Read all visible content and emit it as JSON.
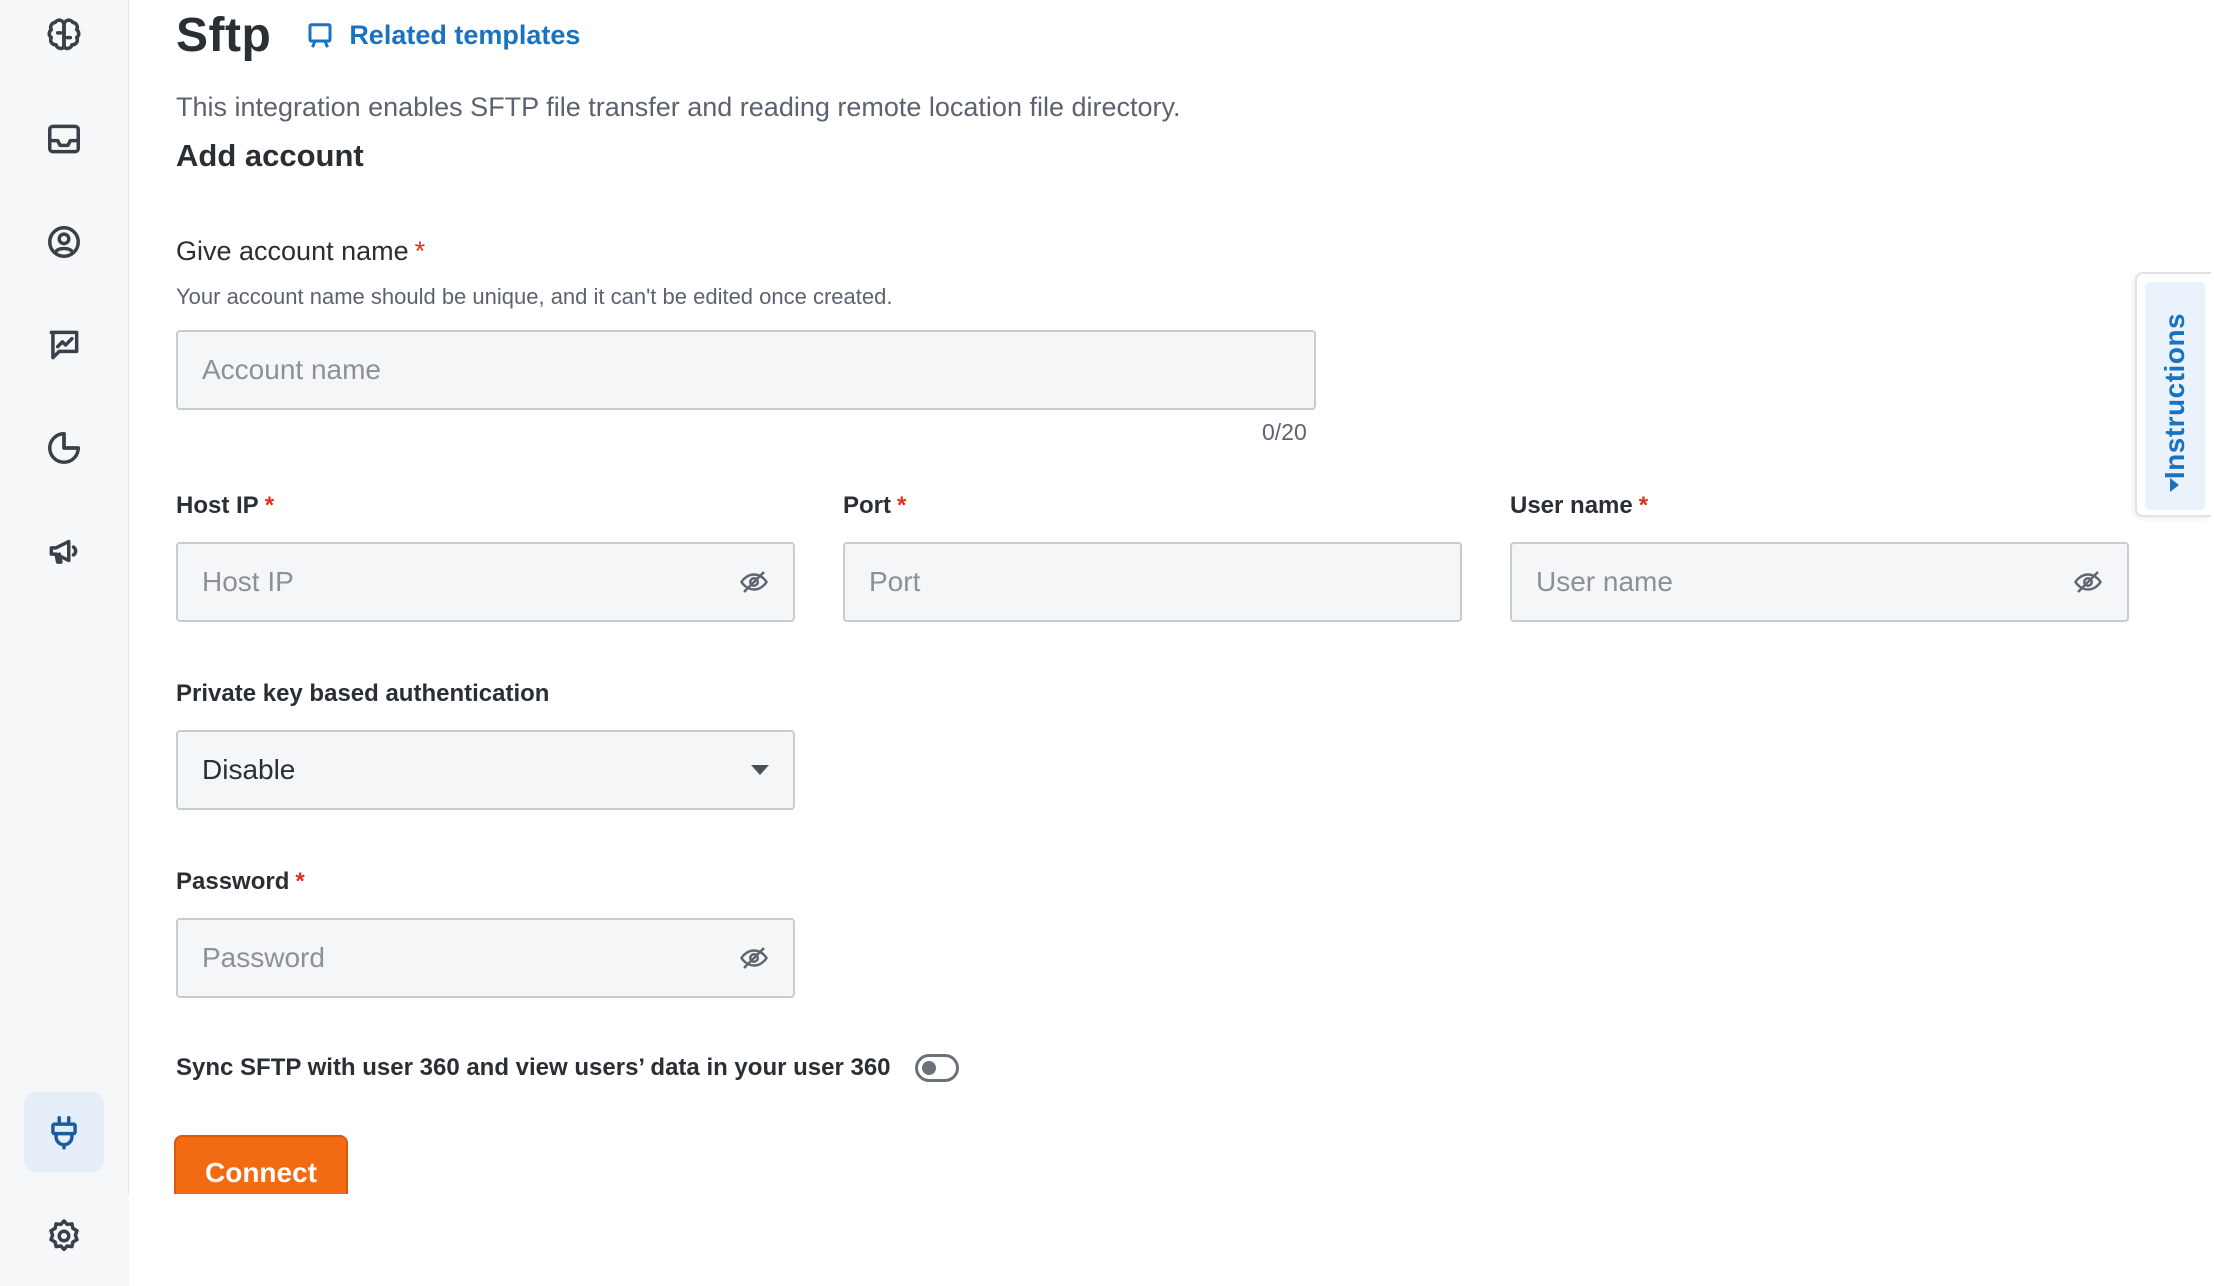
{
  "page": {
    "title": "Sftp",
    "related_templates": "Related templates",
    "description": "This integration enables SFTP file transfer and reading remote location file directory.",
    "section_title": "Add account"
  },
  "account_name": {
    "label": "Give account name",
    "required_mark": "*",
    "hint": "Your account name should be unique, and it can't be edited once created.",
    "placeholder": "Account name",
    "value": "",
    "counter": "0/20"
  },
  "host_ip": {
    "label": "Host IP",
    "required_mark": "*",
    "placeholder": "Host IP",
    "value": ""
  },
  "port": {
    "label": "Port",
    "required_mark": "*",
    "placeholder": "Port",
    "value": ""
  },
  "user_name": {
    "label": "User name",
    "required_mark": "*",
    "placeholder": "User name",
    "value": ""
  },
  "private_key": {
    "label": "Private key based authentication",
    "selected": "Disable"
  },
  "password": {
    "label": "Password",
    "required_mark": "*",
    "placeholder": "Password",
    "value": ""
  },
  "sync": {
    "label": "Sync SFTP with user 360 and view users’ data in your user 360",
    "enabled": false
  },
  "actions": {
    "connect": "Connect"
  },
  "instructions_tab": {
    "label": "Instructions"
  },
  "sidebar": {
    "items": [
      {
        "icon": "brain-icon"
      },
      {
        "icon": "inbox-icon"
      },
      {
        "icon": "user-circle-icon"
      },
      {
        "icon": "chart-chat-icon"
      },
      {
        "icon": "pie-chart-icon"
      },
      {
        "icon": "megaphone-icon"
      },
      {
        "icon": "plug-icon",
        "active": true
      },
      {
        "icon": "gear-icon"
      }
    ]
  },
  "colors": {
    "accent_blue": "#1a73c0",
    "connect_orange": "#f26a12",
    "required_red": "#e0301e"
  }
}
